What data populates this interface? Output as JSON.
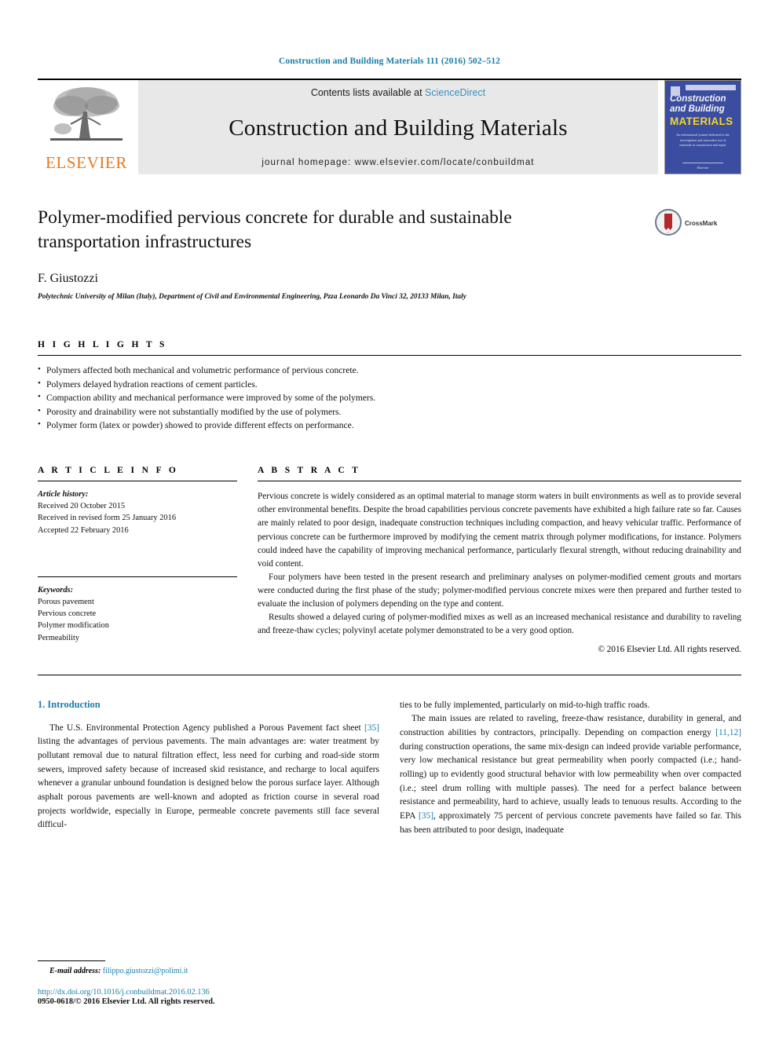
{
  "running_head": "Construction and Building Materials 111 (2016) 502–512",
  "masthead": {
    "publisher_name": "ELSEVIER",
    "contents_prefix": "Contents lists available at ",
    "sciencedirect": "ScienceDirect",
    "journal_title": "Construction and Building Materials",
    "homepage": "journal homepage: www.elsevier.com/locate/conbuildmat",
    "cover": {
      "line1": "Construction",
      "line2": "and Building",
      "line3": "MATERIALS",
      "blurb": "An international journal dedicated to the investigation and innovative use of materials in construction and repair",
      "foot": "Elsevier"
    }
  },
  "article": {
    "title": "Polymer-modified pervious concrete for durable and sustainable transportation infrastructures",
    "author": "F. Giustozzi",
    "affiliation": "Polytechnic University of Milan (Italy), Department of Civil and Environmental Engineering, Pzza Leonardo Da Vinci 32, 20133 Milan, Italy",
    "crossmark_label": "CrossMark"
  },
  "highlights": {
    "label": "H I G H L I G H T S",
    "items": [
      "Polymers affected both mechanical and volumetric performance of pervious concrete.",
      "Polymers delayed hydration reactions of cement particles.",
      "Compaction ability and mechanical performance were improved by some of the polymers.",
      "Porosity and drainability were not substantially modified by the use of polymers.",
      "Polymer form (latex or powder) showed to provide different effects on performance."
    ]
  },
  "article_info": {
    "label": "A R T I C L E   I N F O",
    "history_label": "Article history:",
    "history": [
      "Received 20 October 2015",
      "Received in revised form 25 January 2016",
      "Accepted 22 February 2016"
    ],
    "keywords_label": "Keywords:",
    "keywords": [
      "Porous pavement",
      "Pervious concrete",
      "Polymer modification",
      "Permeability"
    ]
  },
  "abstract": {
    "label": "A B S T R A C T",
    "paragraphs": [
      "Pervious concrete is widely considered as an optimal material to manage storm waters in built environments as well as to provide several other environmental benefits. Despite the broad capabilities pervious concrete pavements have exhibited a high failure rate so far. Causes are mainly related to poor design, inadequate construction techniques including compaction, and heavy vehicular traffic. Performance of pervious concrete can be furthermore improved by modifying the cement matrix through polymer modifications, for instance. Polymers could indeed have the capability of improving mechanical performance, particularly flexural strength, without reducing drainability and void content.",
      "Four polymers have been tested in the present research and preliminary analyses on polymer-modified cement grouts and mortars were conducted during the first phase of the study; polymer-modified pervious concrete mixes were then prepared and further tested to evaluate the inclusion of polymers depending on the type and content.",
      "Results showed a delayed curing of polymer-modified mixes as well as an increased mechanical resistance and durability to raveling and freeze-thaw cycles; polyvinyl acetate polymer demonstrated to be a very good option."
    ],
    "copyright": "© 2016 Elsevier Ltd. All rights reserved."
  },
  "introduction": {
    "heading": "1. Introduction",
    "left_paragraph_part1": "The U.S. Environmental Protection Agency published a Porous Pavement fact sheet ",
    "left_ref1": "[35]",
    "left_paragraph_part2": " listing the advantages of pervious pavements. The main advantages are: water treatment by pollutant removal due to natural filtration effect, less need for curbing and road-side storm sewers, improved safety because of increased skid resistance, and recharge to local aquifers whenever a granular unbound foundation is designed below the porous surface layer. Although asphalt porous pavements are well-known and adopted as friction course in several road projects worldwide, especially in Europe, permeable concrete pavements still face several difficul-",
    "right_continuation": "ties to be fully implemented, particularly on mid-to-high traffic roads.",
    "right_paragraph_part1": "The main issues are related to raveling, freeze-thaw resistance, durability in general, and construction abilities by contractors, principally. Depending on compaction energy ",
    "right_ref1": "[11,12]",
    "right_paragraph_part2": " during construction operations, the same mix-design can indeed provide variable performance, very low mechanical resistance but great permeability when poorly compacted (i.e.; hand-rolling) up to evidently good structural behavior with low permeability when over compacted (i.e.; steel drum rolling with multiple passes). The need for a perfect balance between resistance and permeability, hard to achieve, usually leads to tenuous results. According to the EPA ",
    "right_ref2": "[35]",
    "right_paragraph_part3": ", approximately 75 percent of pervious concrete pavements have failed so far. This has been attributed to poor design, inadequate"
  },
  "footer": {
    "email_label": "E-mail address:",
    "email": "filippo.giustozzi@polimi.it",
    "doi": "http://dx.doi.org/10.1016/j.conbuildmat.2016.02.136",
    "issn_line": "0950-0618/© 2016 Elsevier Ltd. All rights reserved."
  },
  "colors": {
    "link_blue": "#1a7fa8",
    "sciencedirect_blue": "#3c8fc0",
    "elsevier_orange": "#E87722",
    "cover_blue": "#3b4da0",
    "cover_yellow": "#f3d72b"
  }
}
